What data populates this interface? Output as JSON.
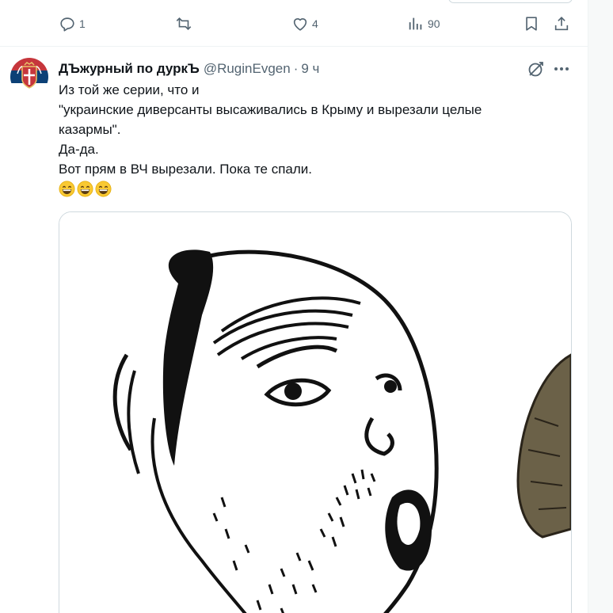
{
  "prev_tweet": {
    "actions": {
      "reply_count": "1",
      "repost_count": "",
      "like_count": "4",
      "views_count": "90"
    }
  },
  "tweet": {
    "author_name": "ДЪжурный по дуркЪ",
    "handle": "@RuginEvgen",
    "separator": "·",
    "time": "9 ч",
    "lines": [
      "Из той же серии, что и",
      "\"украинские диверсанты высаживались в Крыму и вырезали целые",
      "казармы\".",
      "Да-да.",
      "Вот прям в ВЧ вырезали. Пока те спали."
    ],
    "emojis": [
      "grinning-face",
      "grinning-face",
      "grinning-face"
    ],
    "media_description_icon": "meme-image"
  },
  "colors": {
    "text_primary": "#0f1419",
    "text_secondary": "#536471",
    "border": "#cfd9de"
  }
}
